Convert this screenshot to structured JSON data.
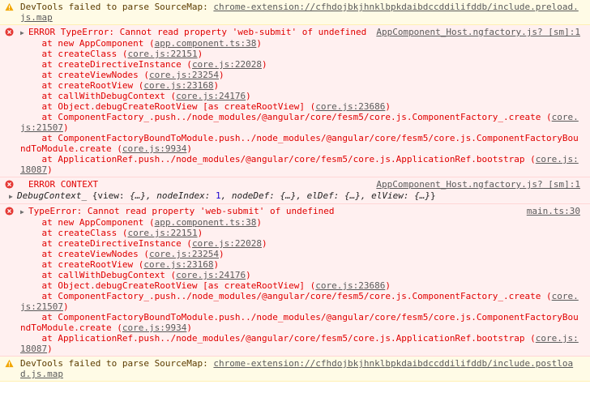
{
  "colors": {
    "warn_bg": "#fffbe6",
    "error_bg": "#fff0f0",
    "error_text": "#e00000",
    "warn_text": "#5c3c00",
    "link": "#5a5a5a"
  },
  "warning1": {
    "icon": "warning-icon",
    "text": "DevTools failed to parse SourceMap: ",
    "link": "chrome-extension://cfhdojbkjhnklbpkdaibdccddilifddb/include.preload.js.map"
  },
  "error1": {
    "icon": "error-icon",
    "title": "ERROR TypeError: Cannot read property 'web-submit' of undefined",
    "source": "AppComponent_Host.ngfactory.js? [sm]:1",
    "stack": [
      {
        "prefix": "    at new AppComponent (",
        "link": "app.component.ts:38",
        "suffix": ")"
      },
      {
        "prefix": "    at createClass (",
        "link": "core.js:22151",
        "suffix": ")"
      },
      {
        "prefix": "    at createDirectiveInstance (",
        "link": "core.js:22028",
        "suffix": ")"
      },
      {
        "prefix": "    at createViewNodes (",
        "link": "core.js:23254",
        "suffix": ")"
      },
      {
        "prefix": "    at createRootView (",
        "link": "core.js:23168",
        "suffix": ")"
      },
      {
        "prefix": "    at callWithDebugContext (",
        "link": "core.js:24176",
        "suffix": ")"
      },
      {
        "prefix": "    at Object.debugCreateRootView [as createRootView] (",
        "link": "core.js:23686",
        "suffix": ")"
      },
      {
        "prefix": "    at ComponentFactory_.push../node_modules/@angular/core/fesm5/core.js.ComponentFactory_.create (",
        "link": "core.js:21507",
        "suffix": ")"
      },
      {
        "prefix": "    at ComponentFactoryBoundToModule.push../node_modules/@angular/core/fesm5/core.js.ComponentFactoryBoundToModule.create (",
        "link": "core.js:9934",
        "suffix": ")"
      },
      {
        "prefix": "    at ApplicationRef.push../node_modules/@angular/core/fesm5/core.js.ApplicationRef.bootstrap (",
        "link": "core.js:18087",
        "suffix": ")"
      }
    ]
  },
  "error2": {
    "icon": "error-icon",
    "title": "ERROR CONTEXT",
    "source": "AppComponent_Host.ngfactory.js? [sm]:1",
    "object_name": "DebugContext_",
    "object_open": " {view: ",
    "view_val": "{…}",
    "node_index_key": ", nodeIndex: ",
    "node_index_val": "1",
    "node_def_key": ", nodeDef: ",
    "node_def_val": "{…}",
    "el_def_key": ", elDef: ",
    "el_def_val": "{…}",
    "el_view_key": ", elView: ",
    "el_view_val": "{…}",
    "object_close": "}"
  },
  "error3": {
    "icon": "error-icon",
    "title": "TypeError: Cannot read property 'web-submit' of undefined",
    "source": "main.ts:30",
    "stack": [
      {
        "prefix": "    at new AppComponent (",
        "link": "app.component.ts:38",
        "suffix": ")"
      },
      {
        "prefix": "    at createClass (",
        "link": "core.js:22151",
        "suffix": ")"
      },
      {
        "prefix": "    at createDirectiveInstance (",
        "link": "core.js:22028",
        "suffix": ")"
      },
      {
        "prefix": "    at createViewNodes (",
        "link": "core.js:23254",
        "suffix": ")"
      },
      {
        "prefix": "    at createRootView (",
        "link": "core.js:23168",
        "suffix": ")"
      },
      {
        "prefix": "    at callWithDebugContext (",
        "link": "core.js:24176",
        "suffix": ")"
      },
      {
        "prefix": "    at Object.debugCreateRootView [as createRootView] (",
        "link": "core.js:23686",
        "suffix": ")"
      },
      {
        "prefix": "    at ComponentFactory_.push../node_modules/@angular/core/fesm5/core.js.ComponentFactory_.create (",
        "link": "core.js:21507",
        "suffix": ")"
      },
      {
        "prefix": "    at ComponentFactoryBoundToModule.push../node_modules/@angular/core/fesm5/core.js.ComponentFactoryBoundToModule.create (",
        "link": "core.js:9934",
        "suffix": ")"
      },
      {
        "prefix": "    at ApplicationRef.push../node_modules/@angular/core/fesm5/core.js.ApplicationRef.bootstrap (",
        "link": "core.js:18087",
        "suffix": ")"
      }
    ]
  },
  "warning2": {
    "icon": "warning-icon",
    "text": "DevTools failed to parse SourceMap: ",
    "link": "chrome-extension://cfhdojbkjhnklbpkdaibdccddilifddb/include.postload.js.map"
  }
}
